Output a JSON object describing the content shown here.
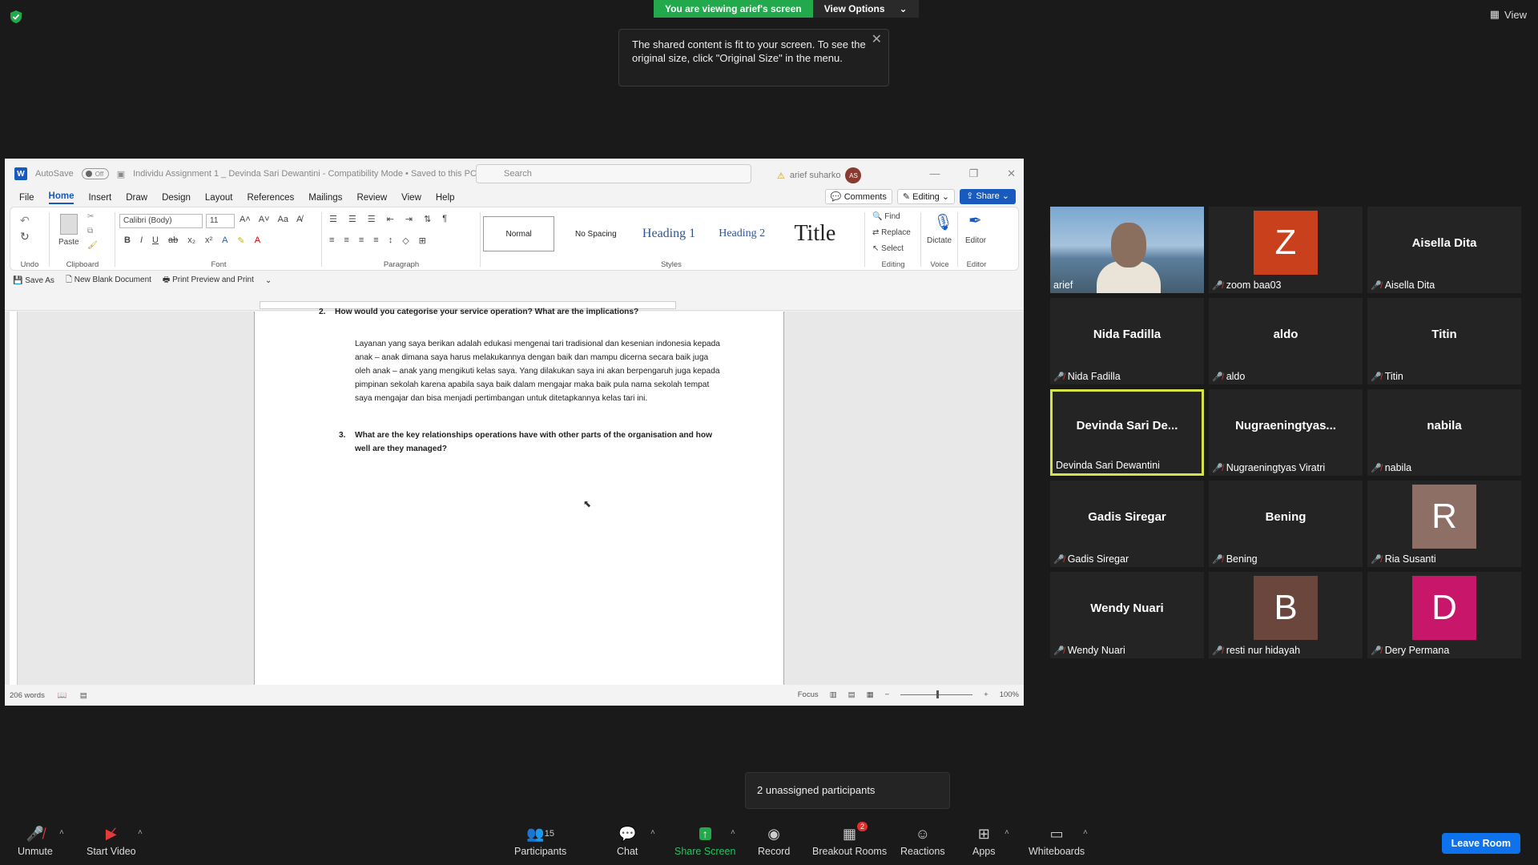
{
  "zoom": {
    "viewing_banner": "You are viewing arief's screen",
    "view_options": "View Options",
    "view_top": "View",
    "tooltip": "The shared content is fit to your screen. To see the original size, click \"Original Size\" in the menu.",
    "unassigned": "2 unassigned participants",
    "toolbar": {
      "unmute": "Unmute",
      "start_video": "Start Video",
      "participants": "Participants",
      "participants_count": "15",
      "chat": "Chat",
      "share_screen": "Share Screen",
      "record": "Record",
      "breakout": "Breakout Rooms",
      "breakout_badge": "2",
      "reactions": "Reactions",
      "apps": "Apps",
      "whiteboards": "Whiteboards",
      "leave": "Leave Room"
    }
  },
  "word": {
    "autosave": "AutoSave",
    "autosave_state": "Off",
    "doc_title": "Individu Assignment 1 _ Devinda Sari Dewantini  -  Compatibility Mode  •  Saved to this PC",
    "search": "Search",
    "user": "arief suharko",
    "user_initials": "AS",
    "menu": [
      "File",
      "Home",
      "Insert",
      "Draw",
      "Design",
      "Layout",
      "References",
      "Mailings",
      "Review",
      "View",
      "Help"
    ],
    "comments": "Comments",
    "editing": "Editing",
    "share": "Share",
    "ribbon": {
      "undo": "Undo",
      "paste": "Paste",
      "clipboard": "Clipboard",
      "font_name": "Calibri (Body)",
      "font_size": "11",
      "font": "Font",
      "paragraph": "Paragraph",
      "styles_label": "Styles",
      "styles": [
        "Normal",
        "No Spacing",
        "Heading 1",
        "Heading 2",
        "Title"
      ],
      "find": "Find",
      "replace": "Replace",
      "select": "Select",
      "editing_group": "Editing",
      "dictate": "Dictate",
      "voice": "Voice",
      "editor": "Editor",
      "editor_group": "Editor"
    },
    "qat": {
      "save_as": "Save As",
      "new_blank": "New Blank Document",
      "print_preview": "Print Preview and Print"
    },
    "doc": {
      "q2_num": "2.",
      "q2": "How would you categorise your service operation?  What are the implications?",
      "para": "Layanan yang saya berikan adalah edukasi mengenai tari tradisional dan kesenian indonesia kepada anak – anak dimana saya harus melakukannya dengan baik dan mampu dicerna secara baik juga oleh anak – anak yang mengikuti kelas saya. Yang dilakukan saya ini akan berpengaruh juga kepada pimpinan sekolah karena apabila saya baik dalam mengajar maka baik pula nama sekolah tempat saya mengajar dan bisa menjadi pertimbangan untuk ditetapkannya kelas tari ini.",
      "q3_num": "3.",
      "q3": "What are the key relationships operations have with other parts of the organisation and how well are they managed?"
    },
    "status": {
      "words": "206 words",
      "focus": "Focus",
      "zoom": "100%"
    }
  },
  "participants": [
    {
      "big": "",
      "name": "arief",
      "muted": false,
      "video": true
    },
    {
      "big": "Z",
      "name": "zoom baa03",
      "muted": true,
      "avatar": "#c8401c"
    },
    {
      "big": "Aisella Dita",
      "name": "Aisella Dita",
      "muted": true
    },
    {
      "big": "Nida Fadilla",
      "name": "Nida Fadilla",
      "muted": true
    },
    {
      "big": "aldo",
      "name": "aldo",
      "muted": true
    },
    {
      "big": "Titin",
      "name": "Titin",
      "muted": true
    },
    {
      "big": "Devinda Sari De...",
      "name": "Devinda Sari Dewantini",
      "muted": false,
      "active": true
    },
    {
      "big": "Nugraeningtyas...",
      "name": "Nugraeningtyas Viratri",
      "muted": true
    },
    {
      "big": "nabila",
      "name": "nabila",
      "muted": true
    },
    {
      "big": "Gadis Siregar",
      "name": "Gadis Siregar",
      "muted": true
    },
    {
      "big": "Bening",
      "name": "Bening",
      "muted": true
    },
    {
      "big": "R",
      "name": "Ria Susanti",
      "muted": true,
      "avatar": "#8e6f66"
    },
    {
      "big": "Wendy Nuari",
      "name": "Wendy Nuari",
      "muted": true
    },
    {
      "big": "B",
      "name": "resti nur hidayah",
      "muted": true,
      "avatar": "#6b463c"
    },
    {
      "big": "D",
      "name": "Dery Permana",
      "muted": true,
      "avatar": "#c8176a"
    }
  ]
}
